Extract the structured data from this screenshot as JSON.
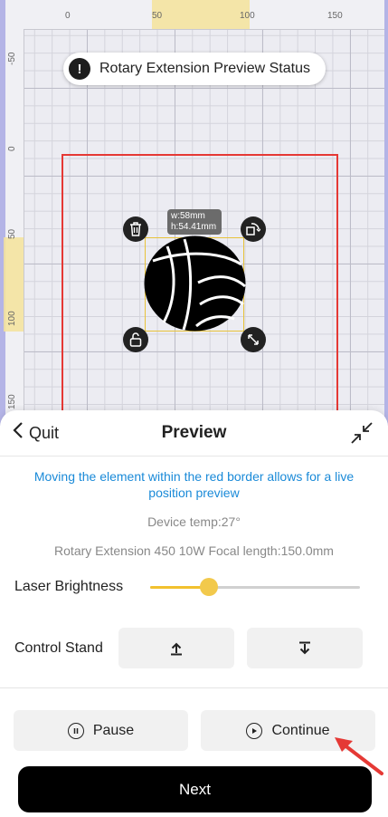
{
  "ruler": {
    "top_ticks": [
      "0",
      "50",
      "100",
      "150"
    ],
    "left_ticks": [
      "-50",
      "0",
      "50",
      "100",
      "150"
    ]
  },
  "status_pill": {
    "label": "Rotary Extension Preview Status",
    "icon": "exclamation-icon"
  },
  "element": {
    "dims_w": "w:58mm",
    "dims_h": "h:54.41mm",
    "image": "volleyball"
  },
  "handles": [
    "trash-icon",
    "rotate-icon",
    "lock-icon",
    "resize-icon"
  ],
  "colors": {
    "border": "#e53935",
    "accent": "#f2c94c",
    "info": "#1a8ad8",
    "primary_button": "#000000"
  },
  "sheet": {
    "quit_label": "Quit",
    "title": "Preview",
    "info_text": "Moving the element within the red border allows for a live position preview",
    "device_temp": "Device temp:27°",
    "device_info": "Rotary Extension 450 10W Focal length:150.0mm",
    "brightness_label": "Laser Brightness",
    "brightness_level": 0.28,
    "control_stand_label": "Control Stand",
    "up_icon": "arrow-up-bar-icon",
    "down_icon": "arrow-down-bar-icon",
    "pause_label": "Pause",
    "continue_label": "Continue",
    "next_label": "Next"
  }
}
